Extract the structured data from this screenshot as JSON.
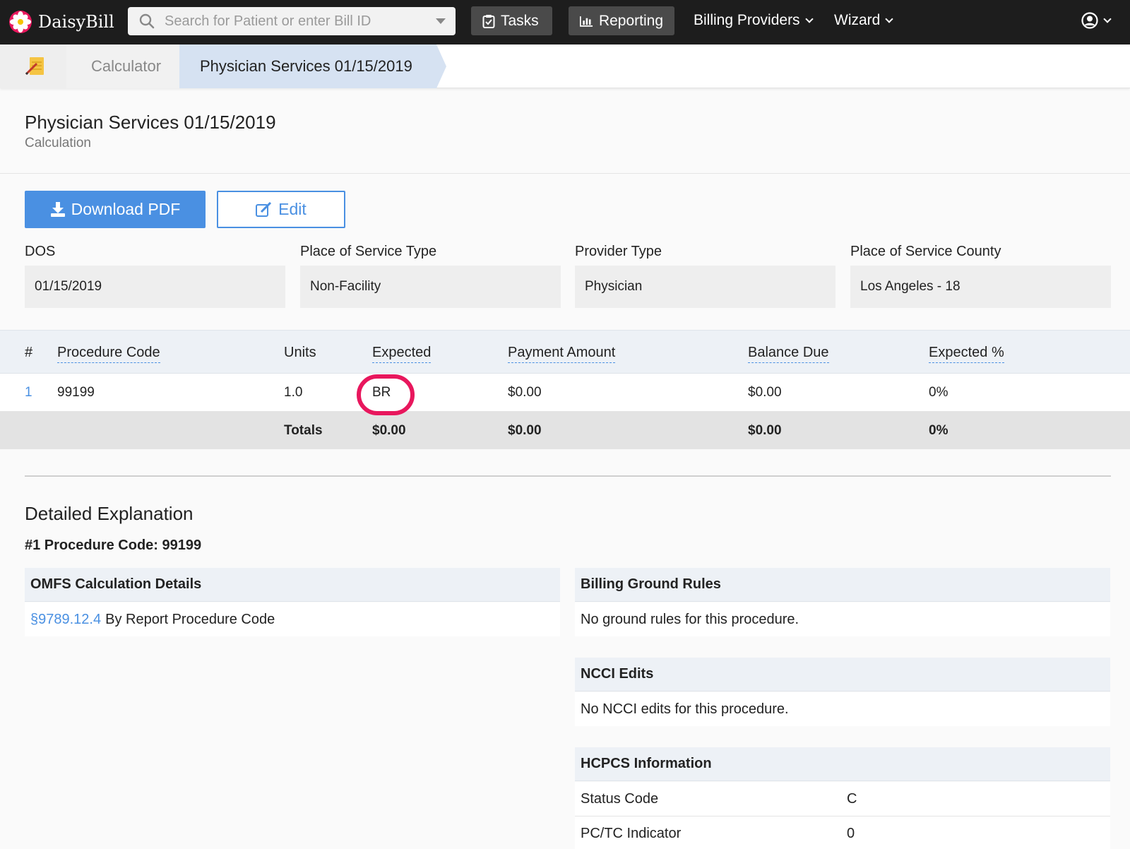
{
  "nav": {
    "brand": "DaisyBill",
    "search_placeholder": "Search for Patient or enter Bill ID",
    "tasks": "Tasks",
    "reporting": "Reporting",
    "billing_providers": "Billing Providers",
    "wizard": "Wizard"
  },
  "breadcrumb": {
    "calculator": "Calculator",
    "active": "Physician Services 01/15/2019"
  },
  "header": {
    "title": "Physician Services 01/15/2019",
    "subtitle": "Calculation"
  },
  "actions": {
    "download": "Download PDF",
    "edit": "Edit"
  },
  "fields": [
    {
      "label": "DOS",
      "value": "01/15/2019"
    },
    {
      "label": "Place of Service Type",
      "value": "Non-Facility"
    },
    {
      "label": "Provider Type",
      "value": "Physician"
    },
    {
      "label": "Place of Service County",
      "value": "Los Angeles - 18"
    }
  ],
  "table": {
    "headers": [
      "#",
      "Procedure Code",
      "Units",
      "Expected",
      "Payment Amount",
      "Balance Due",
      "Expected %"
    ],
    "row": {
      "num": "1",
      "code": "99199",
      "units": "1.0",
      "expected": "BR",
      "payment": "$0.00",
      "balance": "$0.00",
      "pct": "0%"
    },
    "totals": {
      "label": "Totals",
      "expected": "$0.00",
      "payment": "$0.00",
      "balance": "$0.00",
      "pct": "0%"
    }
  },
  "explanation": {
    "title": "Detailed Explanation",
    "procedure": "#1 Procedure Code: 99199",
    "omfs": {
      "title": "OMFS Calculation Details",
      "link": "§9789.12.4",
      "text": "By Report Procedure Code"
    },
    "ground_rules": {
      "title": "Billing Ground Rules",
      "text": "No ground rules for this procedure."
    },
    "ncci": {
      "title": "NCCI Edits",
      "text": "No NCCI edits for this procedure."
    },
    "hcpcs": {
      "title": "HCPCS Information",
      "rows": [
        {
          "label": "Status Code",
          "value": "C"
        },
        {
          "label": "PC/TC Indicator",
          "value": "0"
        }
      ]
    }
  },
  "colors": {
    "accent": "#4a90e2",
    "highlight": "#e8175d",
    "nav_bg": "#1d1d1d"
  }
}
